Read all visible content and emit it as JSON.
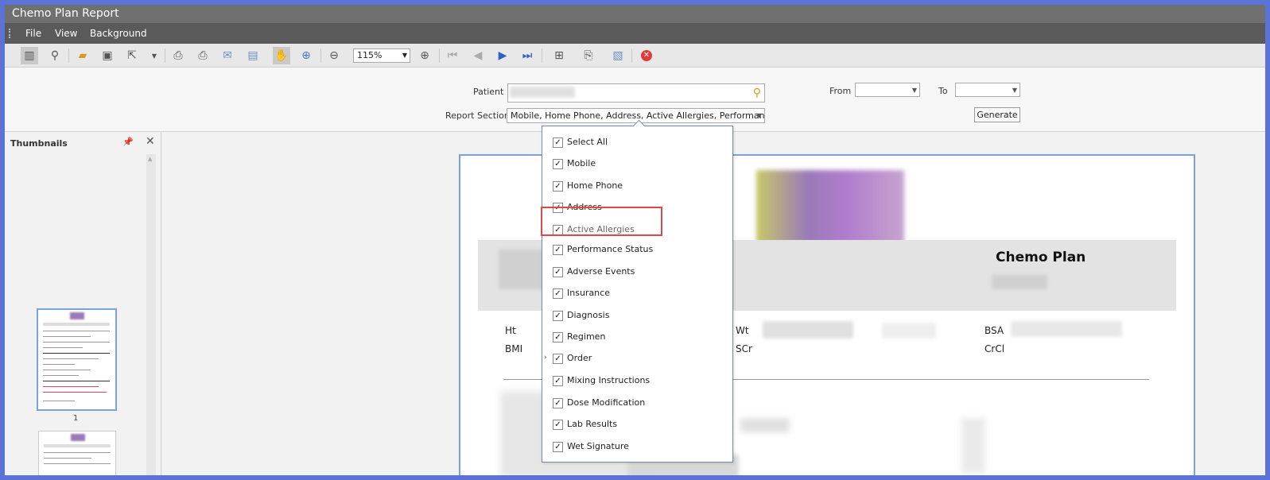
{
  "window": {
    "title": "Chemo Plan Report"
  },
  "menu": [
    "File",
    "View",
    "Background"
  ],
  "toolbar": {
    "zoom": "115%",
    "icons": [
      "toc-icon",
      "find-icon",
      "open-icon",
      "save-icon",
      "export-icon",
      "dropdown-arrow-icon",
      "print-icon",
      "quick-print-icon",
      "email-icon",
      "save-page-icon",
      "hand-tool-icon",
      "magnifier-icon",
      "zoom-out-icon",
      "zoom-in-icon",
      "first-page-icon",
      "previous-page-icon",
      "next-page-icon",
      "last-page-icon",
      "multi-page-icon",
      "page-setup-icon",
      "watermark-icon",
      "close-preview-icon"
    ]
  },
  "params": {
    "patient_label": "Patient",
    "sections_label": "Report Sections",
    "sections_value": "Mobile, Home Phone, Address, Active Allergies, Performance Stat...",
    "from_label": "From",
    "to_label": "To",
    "generate_label": "Generate"
  },
  "thumbnails": {
    "title": "Thumbnails",
    "pages": [
      "1"
    ]
  },
  "report": {
    "title": "Chemo Plan",
    "labels": {
      "ht": "Ht",
      "bmi": "BMI",
      "wt": "Wt",
      "scr": "SCr",
      "bsa": "BSA",
      "crcl": "CrCl"
    }
  },
  "dropdown": {
    "items": [
      {
        "label": "Select All",
        "checked": true
      },
      {
        "label": "Mobile",
        "checked": true
      },
      {
        "label": "Home Phone",
        "checked": true
      },
      {
        "label": "Address",
        "checked": true
      },
      {
        "label": "Active Allergies",
        "checked": true
      },
      {
        "label": "Performance Status",
        "checked": true
      },
      {
        "label": "Adverse Events",
        "checked": true
      },
      {
        "label": "Insurance",
        "checked": true
      },
      {
        "label": "Diagnosis",
        "checked": true
      },
      {
        "label": "Regimen",
        "checked": true
      },
      {
        "label": "Order",
        "checked": true
      },
      {
        "label": "Mixing Instructions",
        "checked": true
      },
      {
        "label": "Dose Modification",
        "checked": true
      },
      {
        "label": "Lab Results",
        "checked": true
      },
      {
        "label": "Wet Signature",
        "checked": true
      }
    ]
  },
  "colors": {
    "highlight": "#e04848",
    "accent": "#7aa3de"
  }
}
